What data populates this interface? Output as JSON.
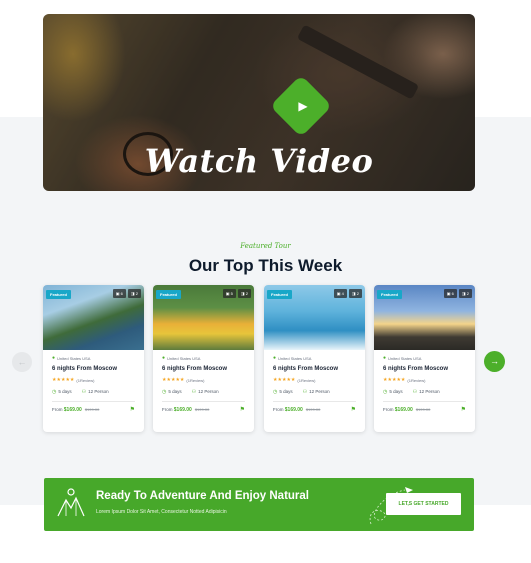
{
  "video": {
    "title": "Watch Video",
    "play_icon": "play-icon"
  },
  "section": {
    "subtitle": "Featured Tour",
    "title": "Our Top This Week"
  },
  "tours": [
    {
      "badge": "Featured",
      "photos": "6",
      "videos": "2",
      "location": "United States USA",
      "title": "6 nights From Moscow",
      "stars": "★★★★★",
      "reviews": "(1Review)",
      "days": "5 days",
      "persons": "12 Person",
      "from": "From",
      "price": "$169.00",
      "old_price": "$199.00"
    },
    {
      "badge": "Featured",
      "photos": "5",
      "videos": "2",
      "location": "United States USA",
      "title": "6 nights From Moscow",
      "stars": "★★★★★",
      "reviews": "(1Review)",
      "days": "5 days",
      "persons": "12 Person",
      "from": "From",
      "price": "$169.00",
      "old_price": "$199.00"
    },
    {
      "badge": "Featured",
      "photos": "4",
      "videos": "2",
      "location": "United States USA",
      "title": "6 nights From Moscow",
      "stars": "★★★★★",
      "reviews": "(1Review)",
      "days": "5 days",
      "persons": "12 Person",
      "from": "From",
      "price": "$169.00",
      "old_price": "$199.00"
    },
    {
      "badge": "Featured",
      "photos": "6",
      "videos": "2",
      "location": "United States USA",
      "title": "6 nights From Moscow",
      "stars": "★★★★★",
      "reviews": "(1Review)",
      "days": "5 days",
      "persons": "12 Person",
      "from": "From",
      "price": "$169.00",
      "old_price": "$199.00"
    }
  ],
  "nav": {
    "prev": "←",
    "next": "→"
  },
  "cta": {
    "title": "Ready To Adventure And Enjoy Natural",
    "subtitle": "Lorem Ipsum Dolor Sit Amet, Consectetur Notted Adipisicin",
    "button": "LET,S GET STARTED"
  },
  "colors": {
    "accent": "#4caf2a",
    "badge": "#19a7c8",
    "star": "#f5a623",
    "heading": "#0e1b2c"
  }
}
